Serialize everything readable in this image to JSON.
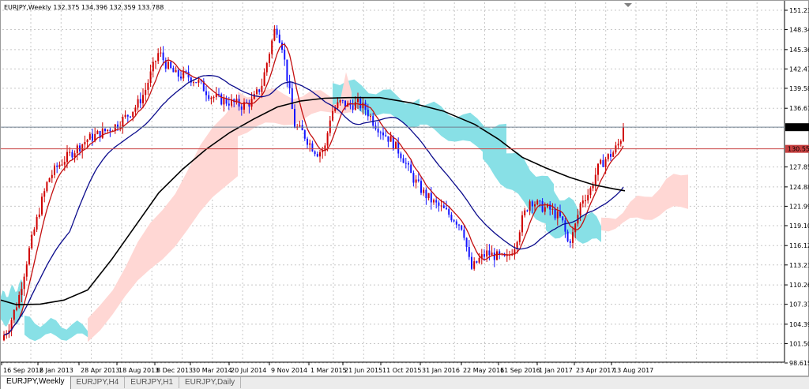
{
  "header": {
    "symbol_label": "EURJPY,Weekly",
    "ohlc": "132.375 134.396 132.359 133.788"
  },
  "colors": {
    "bull": "#1515ff",
    "bear": "#d00000",
    "ma_fast": "#c41010",
    "ma_mid": "#0b0b8c",
    "ma_slow": "#000000",
    "cloud_up": "#88e0e6",
    "cloud_down": "#ffd7d4",
    "bid_line": "#708090",
    "red_line": "#c84040"
  },
  "price_axis": {
    "ticks": [
      "151.230",
      "148.340",
      "145.365",
      "142.475",
      "139.585",
      "136.610",
      "133.788",
      "127.855",
      "124.880",
      "121.990",
      "119.100",
      "116.125",
      "113.235",
      "110.260",
      "107.370",
      "104.395",
      "101.505",
      "98.615"
    ],
    "tick_values": [
      151.23,
      148.34,
      145.365,
      142.475,
      139.585,
      136.61,
      133.72,
      127.855,
      124.88,
      121.99,
      119.1,
      116.125,
      113.235,
      110.26,
      107.37,
      104.395,
      101.505,
      98.615
    ],
    "current_price": "133.788",
    "horizontal_line": "130.553",
    "y_min": 98.615,
    "y_max": 151.23
  },
  "time_axis": {
    "labels": [
      "16 Sep 2012",
      "6 Jan 2013",
      "28 Apr 2013",
      "18 Aug 2013",
      "8 Dec 2013",
      "30 Mar 2014",
      "20 Jul 2014",
      "9 Nov 2014",
      "1 Mar 2015",
      "21 Jun 2015",
      "11 Oct 2015",
      "31 Jan 2016",
      "22 May 2016",
      "11 Sep 2016",
      "1 Jan 2017",
      "23 Apr 2017",
      "13 Aug 2017"
    ]
  },
  "tabs": [
    {
      "label": "EURJPY,Weekly",
      "active": true
    },
    {
      "label": "EURJPY,H4",
      "active": false
    },
    {
      "label": "EURJPY,H1",
      "active": false
    },
    {
      "label": "EURJPY,Daily",
      "active": false
    }
  ]
}
